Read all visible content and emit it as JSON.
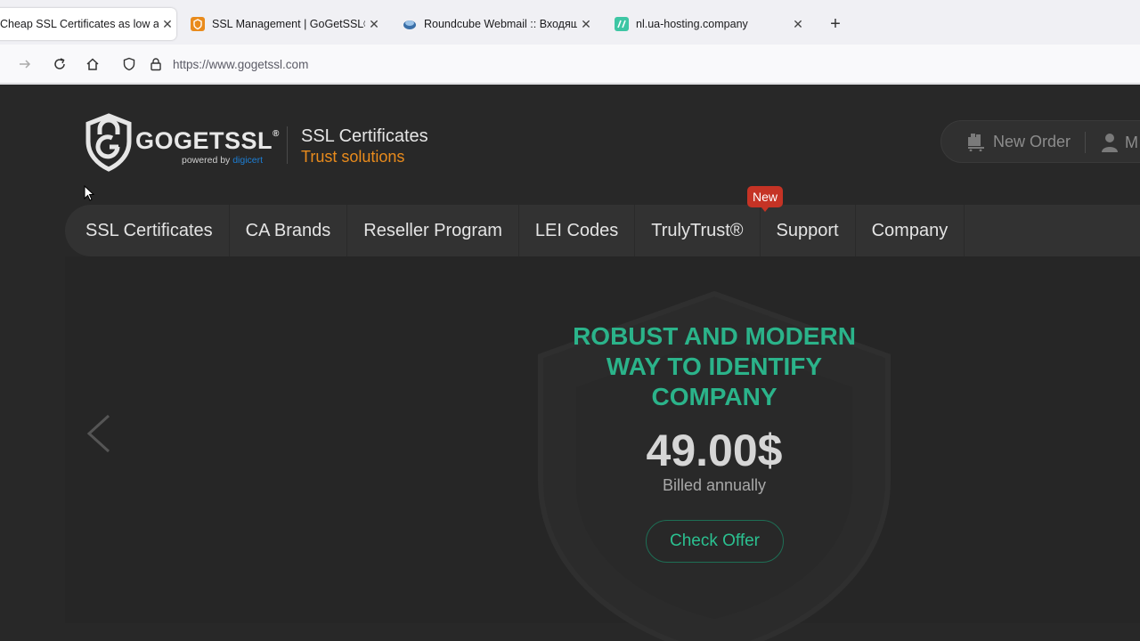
{
  "browser": {
    "tabs": [
      {
        "title": "Cheap SSL Certificates as low as",
        "active": true
      },
      {
        "title": "SSL Management | GoGetSSL®",
        "active": false
      },
      {
        "title": "Roundcube Webmail :: Входящие",
        "active": false
      },
      {
        "title": "nl.ua-hosting.company",
        "active": false
      }
    ],
    "url": "https://www.gogetssl.com"
  },
  "site": {
    "logo": {
      "brand": "GOGETSSL",
      "reg": "®",
      "powered_prefix": "powered by ",
      "powered_brand": "digicert"
    },
    "tagline_main": "SSL Certificates",
    "tagline_sub": "Trust solutions",
    "header_actions": {
      "new_order": "New Order",
      "my_account": "M"
    },
    "nav": [
      {
        "label": "SSL Certificates"
      },
      {
        "label": "CA Brands"
      },
      {
        "label": "Reseller Program"
      },
      {
        "label": "LEI Codes"
      },
      {
        "label": "TrulyTrust®",
        "badge": "New"
      },
      {
        "label": "Support"
      },
      {
        "label": "Company"
      }
    ],
    "hero": {
      "title_line1": "ROBUST AND MODERN",
      "title_line2": "WAY TO IDENTIFY",
      "title_line3": "COMPANY",
      "price": "49.00$",
      "billing": "Billed annually",
      "cta": "Check Offer"
    }
  },
  "colors": {
    "accent_green": "#2bb38a",
    "accent_orange": "#e98b1c",
    "badge_red": "#c53325",
    "page_bg": "#282828"
  }
}
